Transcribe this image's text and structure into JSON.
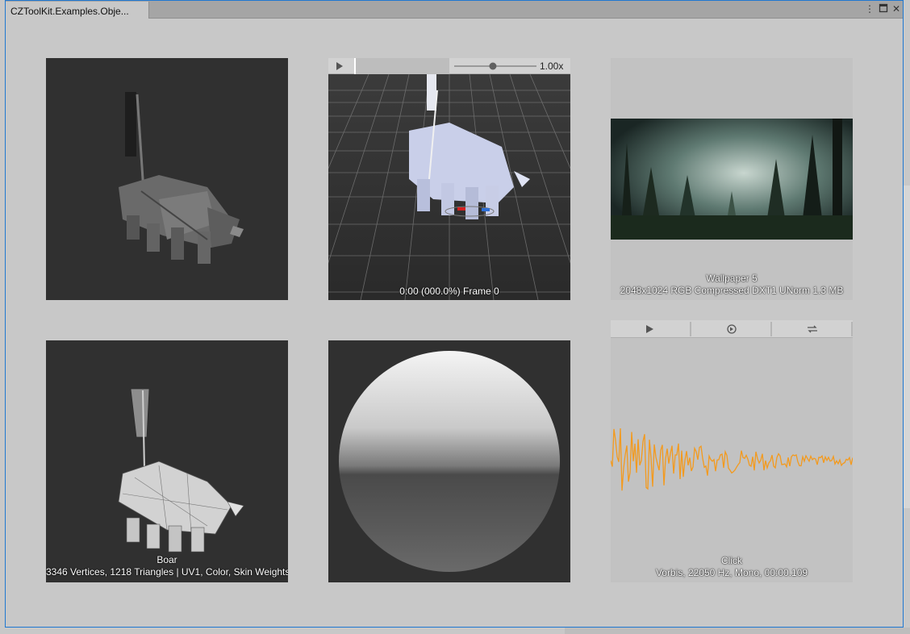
{
  "window": {
    "tab_title": "CZToolKit.Examples.Obje...",
    "menu_icon": "kebab-menu-icon",
    "maximize_icon": "maximize-icon",
    "close_icon": "close-icon"
  },
  "previews": {
    "mesh_preview_1": {},
    "animation_preview": {
      "play_icon": "play-icon",
      "speed_value": "1.00x",
      "progress_fraction": 0.0,
      "speed_slider_fraction": 0.47,
      "status": "0:00 (000.0%) Frame 0"
    },
    "texture_preview": {
      "name": "Wallpaper 5",
      "info": "2048x1024  RGB Compressed DXT1 UNorm   1.3 MB"
    },
    "mesh_preview_2": {
      "name": "Boar",
      "info": "3346 Vertices, 1218 Triangles | UV1, Color, Skin Weights"
    },
    "material_preview": {},
    "audio_preview": {
      "play_icon": "play-icon",
      "autoplay_icon": "auto-play-icon",
      "loop_icon": "loop-icon",
      "name": "Click",
      "info": "Vorbis, 22050 Hz, Mono, 00:00.109",
      "waveform_color": "#f39a1e"
    }
  }
}
